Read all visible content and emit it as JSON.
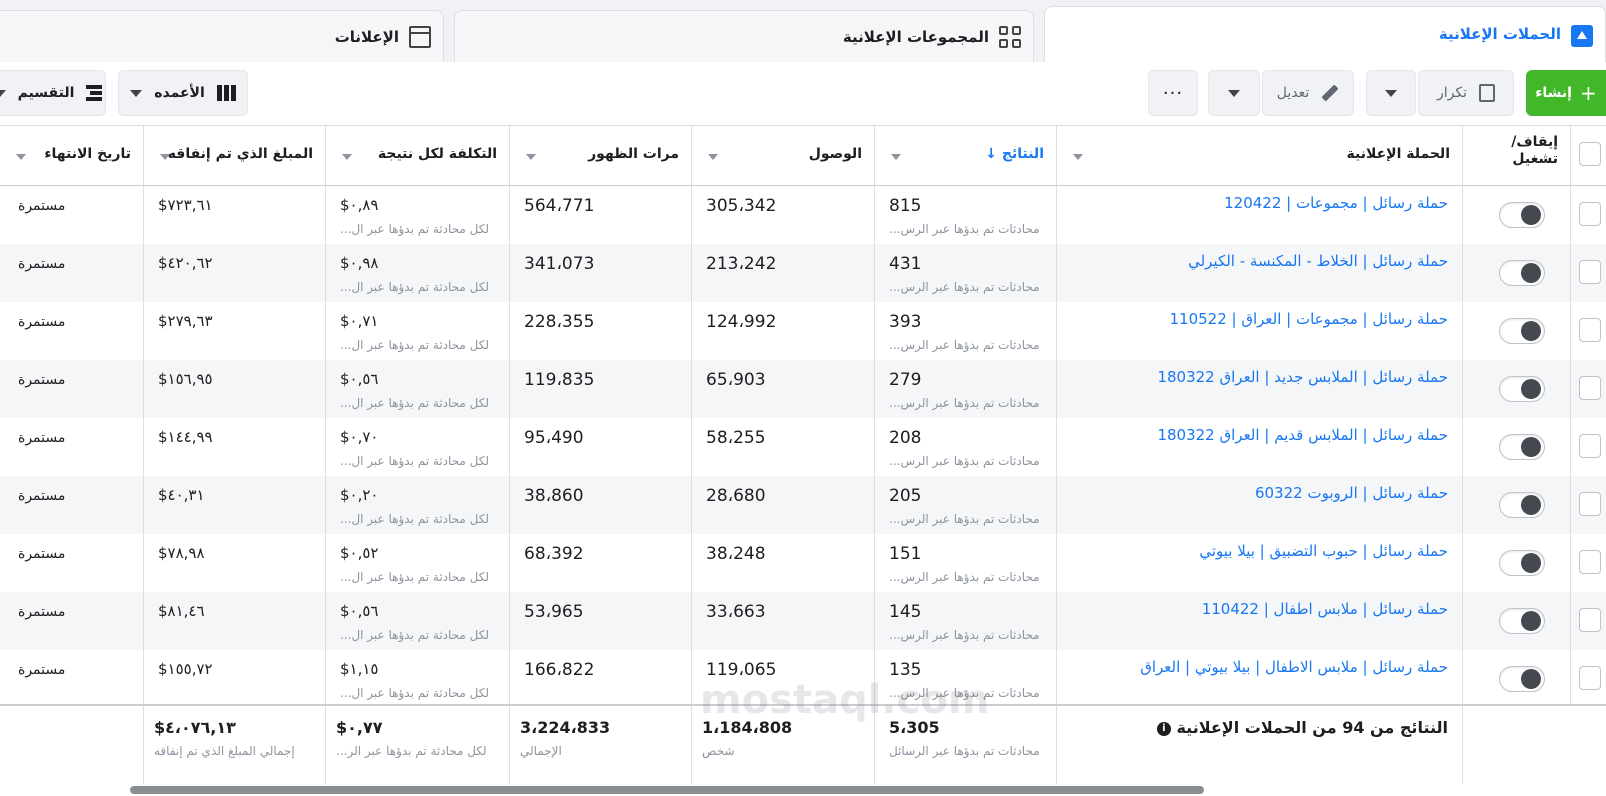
{
  "tabs": {
    "campaigns": "الحملات الإعلانية",
    "adsets": "المجموعات الإعلانية",
    "ads": "الإعلانات"
  },
  "toolbar": {
    "create": "إنشاء",
    "duplicate": "تكرار",
    "edit": "تعديل",
    "more": "···",
    "columns": "الأعمده",
    "breakdown": "التقسيم"
  },
  "headers": {
    "toggle": "إيقاف/ تشغيل",
    "campaign": "الحملة الإعلانية",
    "results": "النتائج ↓",
    "reach": "الوصول",
    "impressions": "مرات الظهور",
    "cost_per_result": "التكلفة لكل نتيجة",
    "amount_spent": "المبلغ الذي تم إنفاقه",
    "end_date": "تاريخ الانتهاء"
  },
  "row_labels": {
    "results_sub": "محادثات تم بدؤها عبر الرس...",
    "cost_sub": "لكل محادثة تم بدؤها عبر ال..."
  },
  "rows": [
    {
      "name": "حملة رسائل | مجموعات | 120422",
      "results": "815",
      "reach": "305،342",
      "impressions": "564،771",
      "cost": "$٠,٨٩",
      "spent": "$٧٢٣,٦١",
      "end": "مستمرة",
      "show_results_sub": true,
      "show_cost_sub": true
    },
    {
      "name": "حملة رسائل | الخلاط - المكنسة - الكيرلي",
      "results": "431",
      "reach": "213،242",
      "impressions": "341،073",
      "cost": "$٠,٩٨",
      "spent": "$٤٢٠,٦٢",
      "end": "مستمرة",
      "show_results_sub": true,
      "show_cost_sub": true
    },
    {
      "name": "حملة رسائل | مجموعات | العراق | 110522",
      "results": "393",
      "reach": "124،992",
      "impressions": "228،355",
      "cost": "$٠,٧١",
      "spent": "$٢٧٩,٦٣",
      "end": "مستمرة",
      "show_results_sub": true,
      "show_cost_sub": true
    },
    {
      "name": "حملة رسائل | الملابس جديد | العراق 180322",
      "results": "279",
      "reach": "65،903",
      "impressions": "119،835",
      "cost": "$٠,٥٦",
      "spent": "$١٥٦,٩٥",
      "end": "مستمرة",
      "show_results_sub": true,
      "show_cost_sub": true
    },
    {
      "name": "حملة رسائل | الملابس قديم | العراق 180322",
      "results": "208",
      "reach": "58،255",
      "impressions": "95،490",
      "cost": "$٠,٧٠",
      "spent": "$١٤٤,٩٩",
      "end": "مستمرة",
      "show_results_sub": true,
      "show_cost_sub": true
    },
    {
      "name": "حملة رسائل | الروبوت 60322",
      "results": "205",
      "reach": "28،680",
      "impressions": "38،860",
      "cost": "$٠,٢٠",
      "spent": "$٤٠,٣١",
      "end": "مستمرة",
      "show_results_sub": true,
      "show_cost_sub": true
    },
    {
      "name": "حملة رسائل | حبوب التضبيق | بيلا بيوتي",
      "results": "151",
      "reach": "38،248",
      "impressions": "68،392",
      "cost": "$٠,٥٢",
      "spent": "$٧٨,٩٨",
      "end": "مستمرة",
      "show_results_sub": true,
      "show_cost_sub": true
    },
    {
      "name": "حملة رسائل | ملابس اطفال | 110422",
      "results": "145",
      "reach": "33،663",
      "impressions": "53،965",
      "cost": "$٠,٥٦",
      "spent": "$٨١,٤٦",
      "end": "مستمرة",
      "show_results_sub": true,
      "show_cost_sub": true
    },
    {
      "name": "حملة رسائل | ملابس الاطفال | بيلا بيوتي | العراق",
      "results": "135",
      "reach": "119،065",
      "impressions": "166،822",
      "cost": "$١,١٥",
      "spent": "$١٥٥,٧٢",
      "end": "مستمرة",
      "show_results_sub": true,
      "show_cost_sub": true
    }
  ],
  "totals": {
    "label": "النتائج من 94 من الحملات الإعلانية",
    "results": "5،305",
    "results_sub": "محادثات تم بدؤها عبر الرسائل",
    "reach": "1،184،808",
    "reach_sub": "شخص",
    "impressions": "3،224،833",
    "impressions_sub": "الإجمالي",
    "cost": "$٠,٧٧",
    "cost_sub": "لكل محادثة تم بدؤها عبر الر...",
    "spent": "$٤،٠٧٦,١٣",
    "spent_sub": "إجمالي المبلغ الذي تم إنفاقه"
  },
  "watermark": "mostaql.com",
  "colors": {
    "accent": "#1877f2",
    "create_green": "#42b72a",
    "muted_text": "#8d949e"
  }
}
